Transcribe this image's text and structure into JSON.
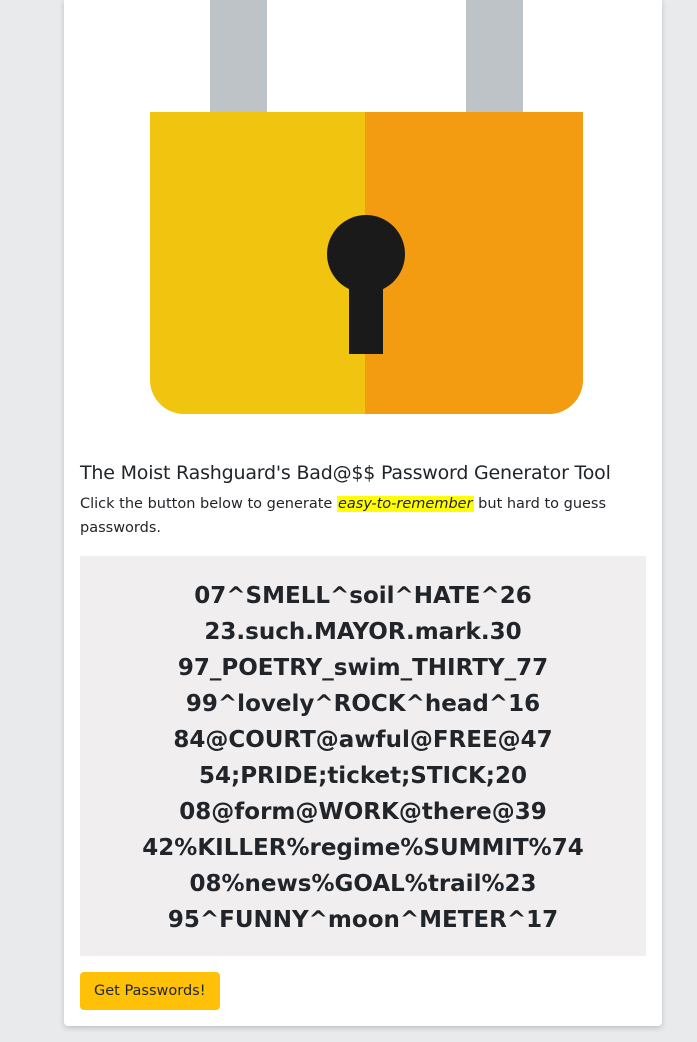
{
  "header": {
    "title": "The Moist Rashguard's Bad@$$ Password Generator Tool"
  },
  "intro": {
    "before": "Click the button below to generate ",
    "highlight": "easy-to-remember",
    "after": " but hard to guess passwords."
  },
  "passwords": [
    "07^SMELL^soil^HATE^26",
    "23.such.MAYOR.mark.30",
    "97_POETRY_swim_THIRTY_77",
    "99^lovely^ROCK^head^16",
    "84@COURT@awful@FREE@47",
    "54;PRIDE;ticket;STICK;20",
    "08@form@WORK@there@39",
    "42%KILLER%regime%SUMMIT%74",
    "08%news%GOAL%trail%23",
    "95^FUNNY^moon^METER^17"
  ],
  "actions": {
    "get_passwords_label": "Get Passwords!"
  },
  "colors": {
    "lock_left": "#f1c40f",
    "lock_right": "#f39c12",
    "shackle": "#bdc3c7",
    "keyhole": "#1a1a1a",
    "button": "#ffc107",
    "highlight": "#ffff00",
    "password_box": "#f0eeef"
  },
  "icons": {
    "hero": "padlock-icon"
  }
}
